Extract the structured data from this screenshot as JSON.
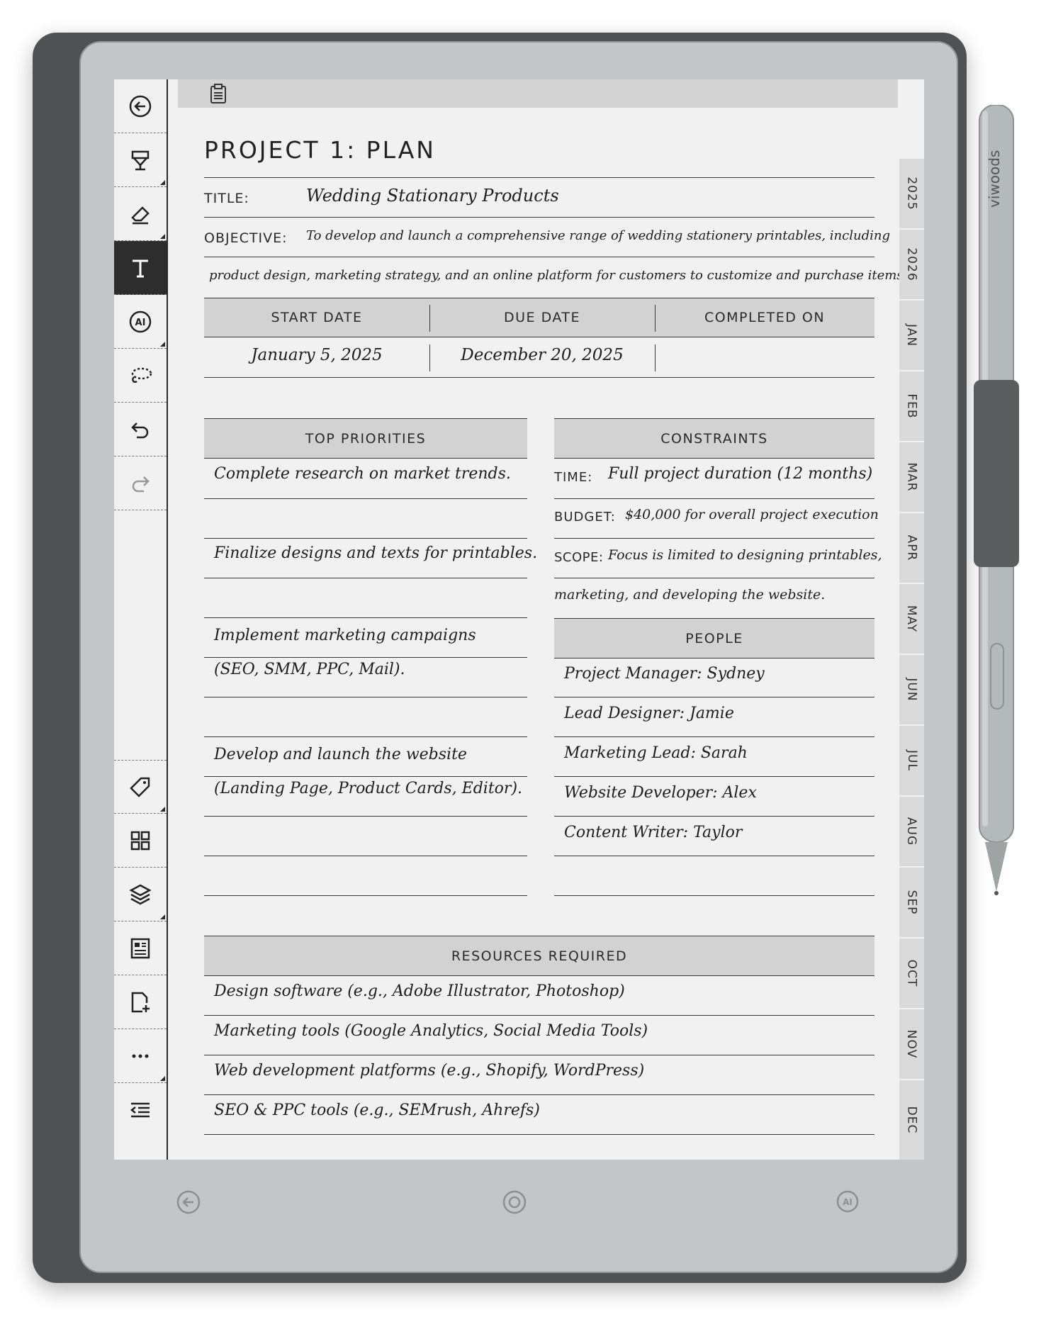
{
  "brand": "viwoods",
  "page": {
    "title": "PROJECT 1: PLAN",
    "title_label": "TITLE:",
    "title_value": "Wedding Stationary Products",
    "objective_label": "OBJECTIVE:",
    "objective_line1": "To develop and launch a comprehensive range of wedding stationery printables, including",
    "objective_line2": "product design, marketing strategy, and an online platform for customers to customize and purchase items.",
    "dates": {
      "start_label": "START DATE",
      "due_label": "DUE DATE",
      "completed_label": "COMPLETED ON",
      "start_value": "January 5, 2025",
      "due_value": "December 20, 2025",
      "completed_value": ""
    },
    "priorities": {
      "header": "TOP PRIORITIES",
      "items": [
        "Complete research on market trends.",
        "",
        "Finalize designs and texts for printables.",
        "",
        "Implement marketing campaigns",
        "(SEO, SMM, PPC, Mail).",
        "",
        "Develop and launch the website",
        "(Landing Page, Product Cards, Editor).",
        "",
        ""
      ]
    },
    "constraints": {
      "header": "CONSTRAINTS",
      "time_label": "TIME:",
      "time_value": "Full project duration (12 months)",
      "budget_label": "BUDGET:",
      "budget_value": "$40,000 for overall project execution",
      "scope_label": "SCOPE:",
      "scope_value": "Focus is limited to designing printables,",
      "scope_value2": "marketing, and developing the website."
    },
    "people": {
      "header": "PEOPLE",
      "items": [
        "Project Manager: Sydney",
        "Lead Designer: Jamie",
        "Marketing Lead: Sarah",
        "Website Developer: Alex",
        "Content Writer: Taylor",
        ""
      ]
    },
    "resources": {
      "header": "RESOURCES REQUIRED",
      "items": [
        "Design software (e.g., Adobe Illustrator, Photoshop)",
        "Marketing tools (Google Analytics, Social Media Tools)",
        "Web development platforms (e.g., Shopify, WordPress)",
        "SEO & PPC tools (e.g., SEMrush, Ahrefs)"
      ]
    }
  },
  "tabs": [
    "2025",
    "2026",
    "JAN",
    "FEB",
    "MAR",
    "APR",
    "MAY",
    "JUN",
    "JUL",
    "AUG",
    "SEP",
    "OCT",
    "NOV",
    "DEC"
  ],
  "toolbar": {
    "top": [
      "back-icon",
      "pen-icon",
      "eraser-icon",
      "text-icon",
      "ai-icon",
      "lasso-icon",
      "undo-icon",
      "redo-icon"
    ],
    "bottom": [
      "tag-icon",
      "grid-icon",
      "layers-icon",
      "template-icon",
      "add-page-icon",
      "more-icon",
      "collapse-icon"
    ],
    "active": "text-icon"
  },
  "hardware_buttons": [
    "back-button",
    "home-button",
    "ai-button"
  ]
}
